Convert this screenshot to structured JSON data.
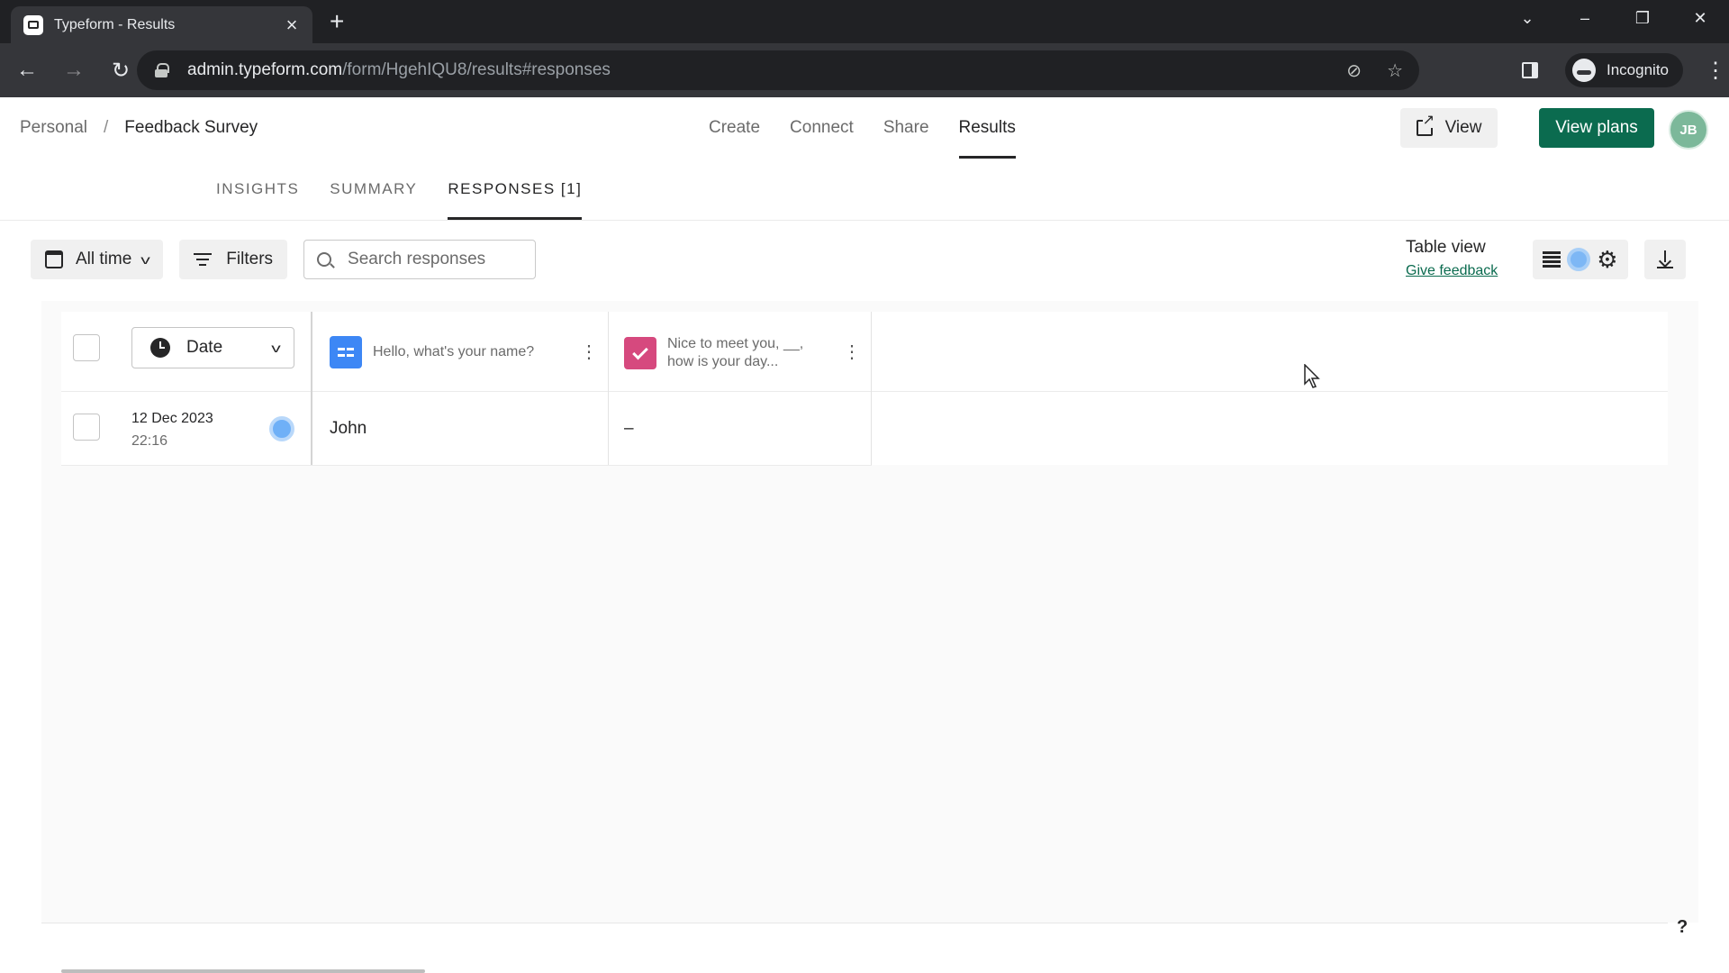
{
  "browser": {
    "tab_title": "Typeform - Results",
    "url_host": "admin.typeform.com",
    "url_path": "/form/HgehIQU8/results#responses",
    "profile_label": "Incognito"
  },
  "header": {
    "breadcrumb": [
      "Personal",
      "Feedback Survey"
    ],
    "nav": [
      "Create",
      "Connect",
      "Share",
      "Results"
    ],
    "active_nav": "Results",
    "view_label": "View",
    "plans_label": "View plans",
    "avatar_initials": "JB"
  },
  "subtabs": [
    "INSIGHTS",
    "SUMMARY",
    "RESPONSES [1]"
  ],
  "toolbar": {
    "date_range": "All time",
    "filters_label": "Filters",
    "search_placeholder": "Search responses",
    "table_view_title": "Table view",
    "feedback_link": "Give feedback"
  },
  "table": {
    "date_column": "Date",
    "columns": [
      {
        "label": "Hello, what's your name?",
        "icon": "short-text-icon"
      },
      {
        "label_line1": "Nice to meet you, __,",
        "label_line2": "how is your day...",
        "icon": "checkbox-choice-icon"
      }
    ],
    "rows": [
      {
        "date": "12 Dec 2023",
        "time": "22:16",
        "name": "John",
        "day": "–"
      }
    ]
  },
  "help_label": "?",
  "colors": {
    "brand_green": "#0b6b4f",
    "question_blue": "#3d87f5",
    "question_pink": "#d6497e"
  }
}
